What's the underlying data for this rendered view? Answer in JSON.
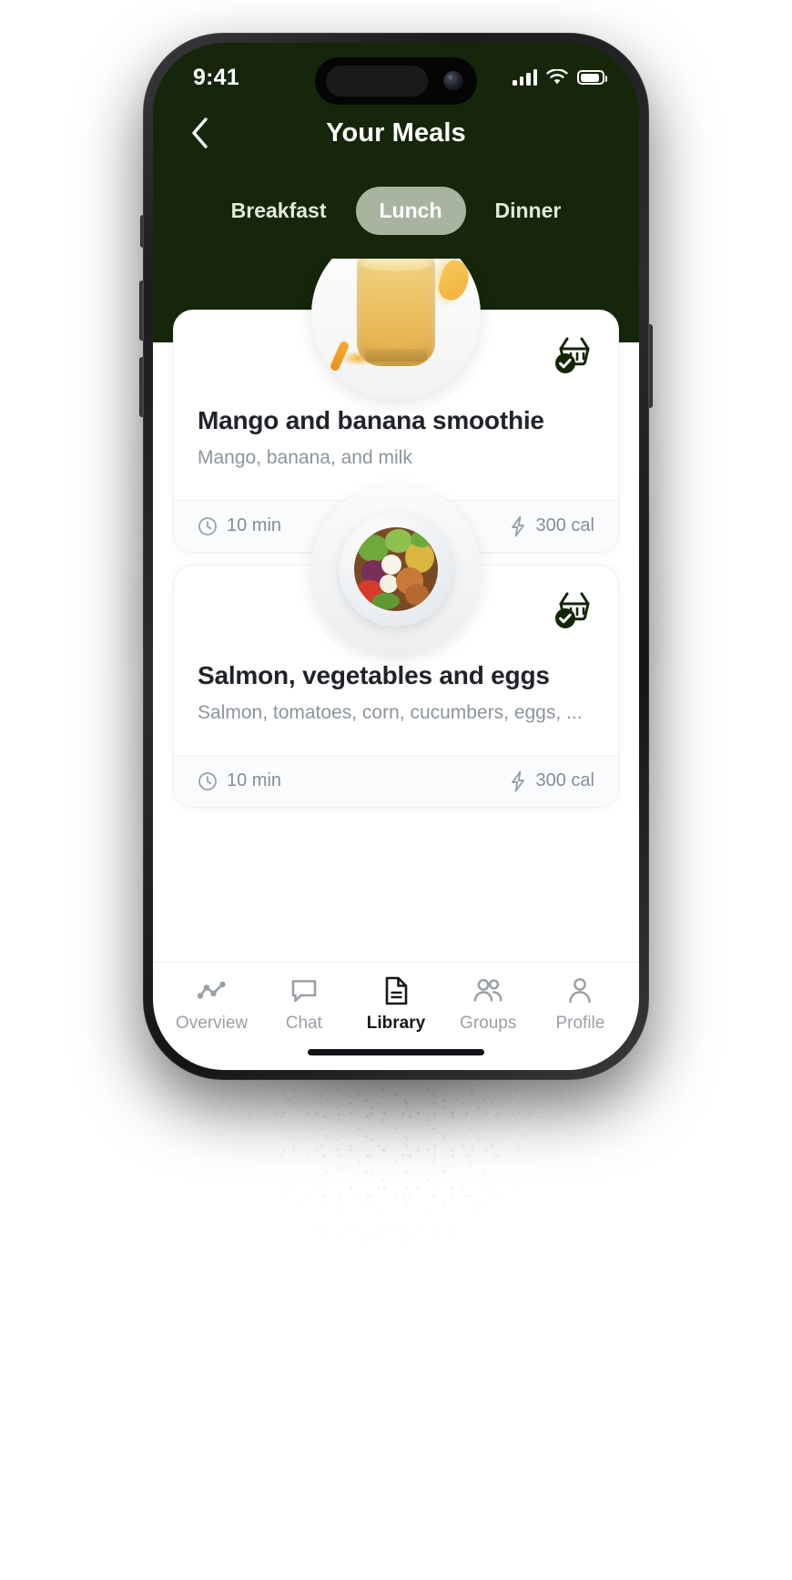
{
  "status_bar": {
    "time": "9:41",
    "signal_icon": "cellular-signal-icon",
    "wifi_icon": "wifi-icon",
    "battery_icon": "battery-icon"
  },
  "header": {
    "back_icon": "chevron-left-icon",
    "title": "Your Meals"
  },
  "tabs": [
    {
      "label": "Breakfast",
      "active": false
    },
    {
      "label": "Lunch",
      "active": true
    },
    {
      "label": "Dinner",
      "active": false
    }
  ],
  "meals": [
    {
      "title": "Mango and banana smoothie",
      "subtitle": "Mango, banana, and milk",
      "time": "10 min",
      "calories": "300 cal",
      "time_icon": "clock-icon",
      "calories_icon": "lightning-bolt-icon",
      "basket_icon": "basket-check-icon",
      "image": "mango-banana-smoothie-photo"
    },
    {
      "title": "Salmon, vegetables and eggs",
      "subtitle": "Salmon, tomatoes, corn, cucumbers, eggs, ...",
      "time": "10 min",
      "calories": "300 cal",
      "time_icon": "clock-icon",
      "calories_icon": "lightning-bolt-icon",
      "basket_icon": "basket-check-icon",
      "image": "salmon-vegetables-eggs-photo"
    }
  ],
  "bottom_nav": [
    {
      "label": "Overview",
      "icon": "activity-chart-icon",
      "active": false
    },
    {
      "label": "Chat",
      "icon": "speech-bubble-icon",
      "active": false
    },
    {
      "label": "Library",
      "icon": "document-icon",
      "active": true
    },
    {
      "label": "Groups",
      "icon": "people-icon",
      "active": false
    },
    {
      "label": "Profile",
      "icon": "person-icon",
      "active": false
    }
  ],
  "colors": {
    "background_green": "#16260a",
    "tab_active_pill": "#a9b4a0",
    "card_white": "#ffffff",
    "title_dark": "#20242a",
    "muted_text": "#8d949c",
    "basket_dark_green": "#132605"
  }
}
